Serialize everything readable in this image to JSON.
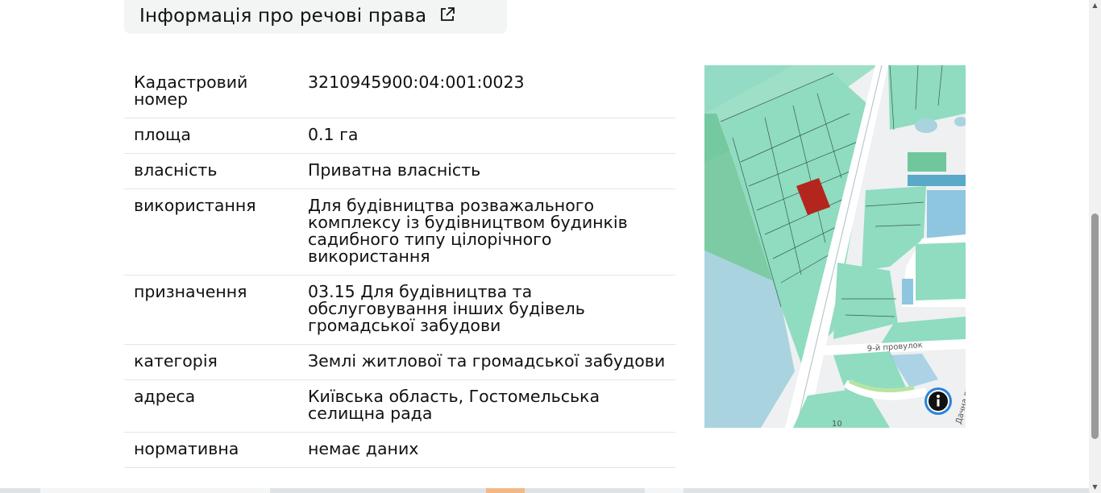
{
  "header": {
    "title": "Інформація про речові права"
  },
  "details": {
    "rows": [
      {
        "label": "Кадастровий номер",
        "value": "3210945900:04:001:0023"
      },
      {
        "label": "площа",
        "value": "0.1 га"
      },
      {
        "label": "власність",
        "value": "Приватна власність"
      },
      {
        "label": "використання",
        "value": "Для будівництва розважального комплексу із будівництвом будинків садибного типу цілорічного використання"
      },
      {
        "label": "призначення",
        "value": "03.15 Для будівництва та обслуговування інших будівель громадської забудови"
      },
      {
        "label": "категорія",
        "value": "Землі житлової та громадської забудови"
      },
      {
        "label": "адреса",
        "value": "Київська область, Гостомельська селищна рада"
      },
      {
        "label": "нормативна",
        "value": "немає даних"
      }
    ]
  },
  "map": {
    "street_label_1": "9-й провулок",
    "street_label_2": "Дачна вулиця",
    "street_label_3": "10",
    "info_icon": "info-icon",
    "colors": {
      "parcel_fill": "#8fdcc0",
      "water": "#a9d3df",
      "highlight": "#b3261e",
      "road": "#ffffff"
    }
  },
  "icons": {
    "external_link": "external-link-icon"
  }
}
